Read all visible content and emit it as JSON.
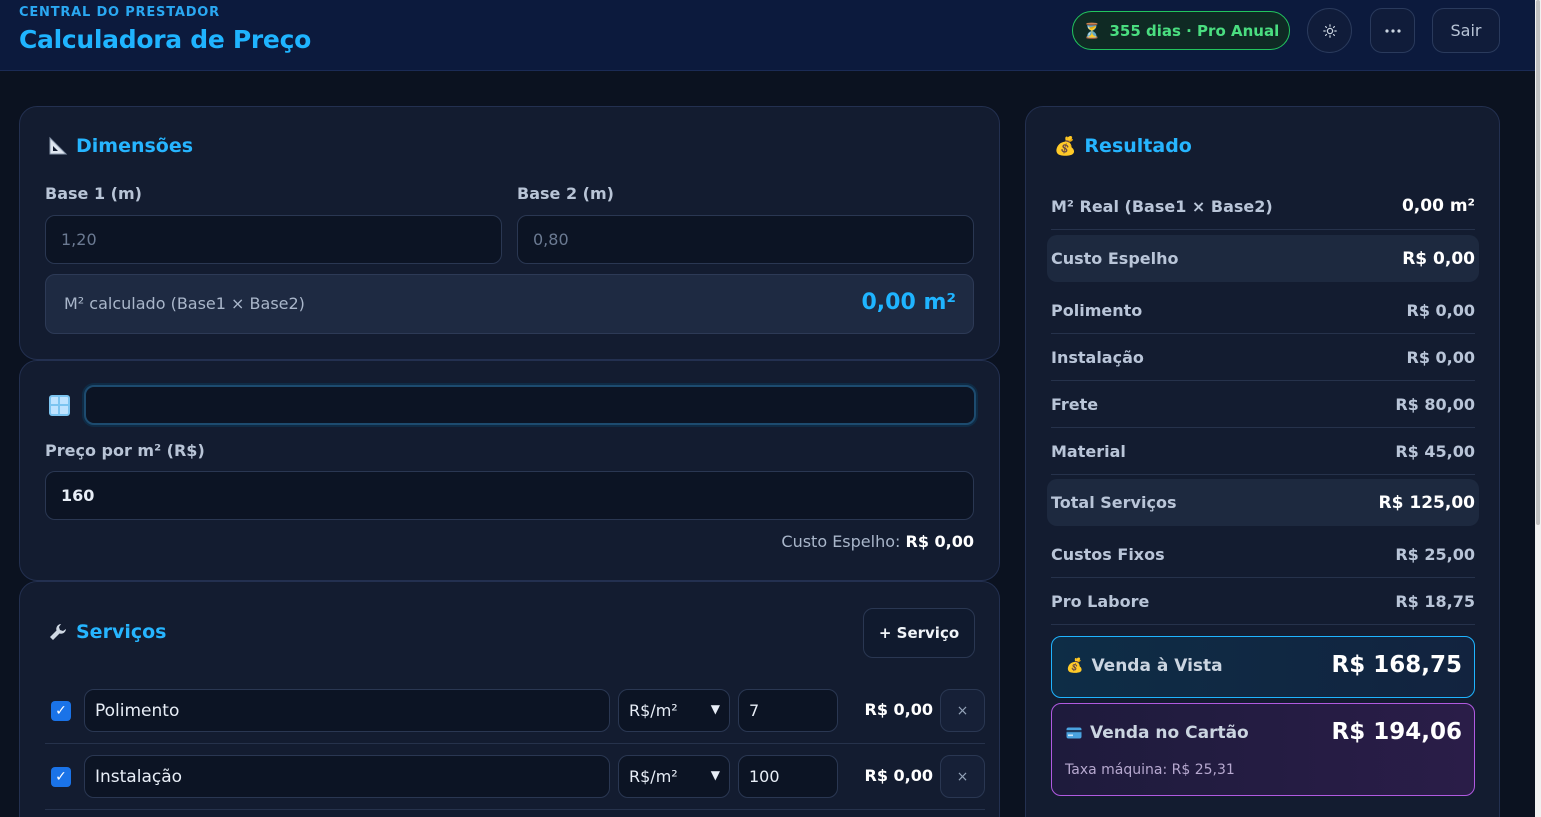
{
  "header": {
    "subtitle": "CENTRAL DO PRESTADOR",
    "title": "Calculadora de Preço",
    "plan_badge": "355 dias · Pro Anual",
    "theme_icon": "sun-icon",
    "more_icon": "ellipsis-icon",
    "logout_label": "Sair"
  },
  "dimensions": {
    "title": "Dimensões",
    "base1_label": "Base 1 (m)",
    "base1_placeholder": "1,20",
    "base2_label": "Base 2 (m)",
    "base2_placeholder": "0,80",
    "calc_label": "M² calculado (Base1 × Base2)",
    "calc_value": "0,00 m²"
  },
  "glass": {
    "name_value": "",
    "price_label": "Preço por m² (R$)",
    "price_value": "160",
    "cost_label": "Custo Espelho:",
    "cost_value": "R$ 0,00"
  },
  "services": {
    "title": "Serviços",
    "add_label": "+ Serviço",
    "items": [
      {
        "checked": true,
        "name": "Polimento",
        "unit": "R$/m²",
        "qty": "7",
        "total": "R$ 0,00"
      },
      {
        "checked": true,
        "name": "Instalação",
        "unit": "R$/m²",
        "qty": "100",
        "total": "R$ 0,00"
      }
    ]
  },
  "result": {
    "title": "Resultado",
    "rows": [
      {
        "label": "M² Real (Base1 × Base2)",
        "value": "0,00 m²"
      },
      {
        "label": "Custo Espelho",
        "value": "R$ 0,00"
      },
      {
        "label": "Polimento",
        "value": "R$ 0,00"
      },
      {
        "label": "Instalação",
        "value": "R$ 0,00"
      },
      {
        "label": "Frete",
        "value": "R$ 80,00"
      },
      {
        "label": "Material",
        "value": "R$ 45,00"
      },
      {
        "label": "Total Serviços",
        "value": "R$ 125,00"
      },
      {
        "label": "Custos Fixos",
        "value": "R$ 25,00"
      },
      {
        "label": "Pro Labore",
        "value": "R$ 18,75"
      }
    ],
    "cash_label": "Venda à Vista",
    "cash_value": "R$ 168,75",
    "card_label": "Venda no Cartão",
    "card_value": "R$ 194,06",
    "card_fee": "Taxa máquina: R$ 25,31"
  },
  "colors": {
    "accent": "#1fb4ff",
    "badge_green": "#22c55e",
    "card_border": "#b05ae0"
  }
}
